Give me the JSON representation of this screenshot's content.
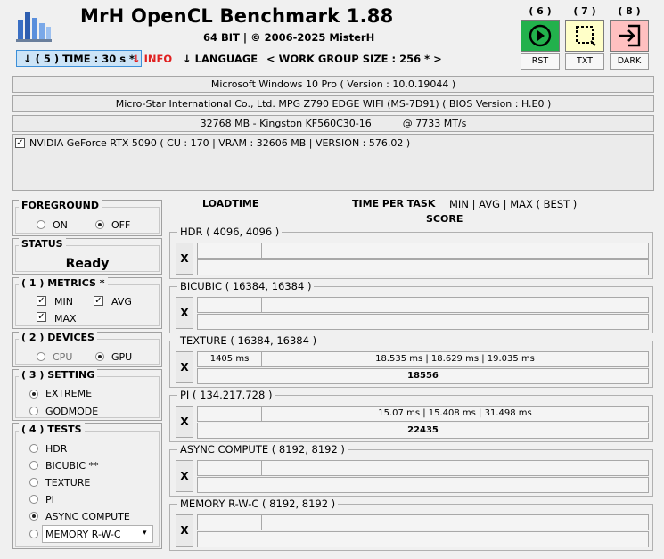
{
  "header": {
    "title": "MrH OpenCL Benchmark 1.88",
    "subtitle": "64 BIT | ©  2006-2025 MisterH"
  },
  "toolbar": {
    "run": {
      "number": "( 6 )",
      "label": "RST",
      "color": "#22b14c"
    },
    "txt": {
      "number": "( 7 )",
      "label": "TXT",
      "color": "#ffffc8"
    },
    "dark": {
      "number": "( 8 )",
      "label": "DARK",
      "color": "#ffc0c0"
    }
  },
  "menu": {
    "time": "↓ ( 5 ) TIME : 30 s *",
    "info": "↓ INFO",
    "language": "↓ LANGUAGE",
    "workgroup": "< WORK GROUP SIZE : 256 * >",
    "info_color": "#e02020"
  },
  "system": {
    "os": "Microsoft Windows 10 Pro ( Version : 10.0.19044 )",
    "board": "Micro-Star International Co., Ltd. MPG Z790 EDGE WIFI (MS-7D91) ( BIOS Version : H.E0 )",
    "memory": "32768 MB - Kingston KF560C30-16          @ 7733 MT/s",
    "gpu": "NVIDIA GeForce RTX 5090 ( CU : 170 | VRAM : 32606 MB | VERSION : 576.02 )"
  },
  "foreground": {
    "title": "FOREGROUND",
    "on": "ON",
    "off": "OFF",
    "selected": "OFF"
  },
  "status": {
    "title": "STATUS",
    "value": "Ready"
  },
  "metrics": {
    "title": "( 1 ) METRICS *",
    "min": "MIN",
    "avg": "AVG",
    "max": "MAX"
  },
  "devices": {
    "title": "( 2 ) DEVICES",
    "cpu": "CPU",
    "gpu": "GPU",
    "selected": "GPU"
  },
  "setting": {
    "title": "( 3 ) SETTING",
    "extreme": "EXTREME",
    "godmode": "GODMODE",
    "selected": "EXTREME"
  },
  "tests_menu": {
    "title": "( 4 ) TESTS",
    "items": [
      "HDR",
      "BICUBIC **",
      "TEXTURE",
      "PI",
      "ASYNC COMPUTE",
      "MEMORY R-W-C"
    ],
    "selected": "ASYNC COMPUTE"
  },
  "columns": {
    "loadtime": "LOADTIME",
    "time_per_task": "TIME PER TASK",
    "minavgmax": "MIN | AVG | MAX ( BEST )",
    "score": "SCORE"
  },
  "results": [
    {
      "name": "HDR ( 4096, 4096 )",
      "button": "X",
      "loadtime": "",
      "times": "",
      "score": ""
    },
    {
      "name": "BICUBIC ( 16384, 16384 )",
      "button": "X",
      "loadtime": "",
      "times": "",
      "score": ""
    },
    {
      "name": "TEXTURE ( 16384, 16384 )",
      "button": "X",
      "loadtime": "1405 ms",
      "times": "18.535 ms | 18.629 ms | 19.035 ms",
      "score": "18556"
    },
    {
      "name": "PI ( 134.217.728 )",
      "button": "X",
      "loadtime": "",
      "times": "15.07 ms | 15.408 ms | 31.498 ms",
      "score": "22435"
    },
    {
      "name": "ASYNC COMPUTE ( 8192, 8192 )",
      "button": "X",
      "loadtime": "",
      "times": "",
      "score": ""
    },
    {
      "name": "MEMORY R-W-C ( 8192, 8192 )",
      "button": "X",
      "loadtime": "",
      "times": "",
      "score": ""
    }
  ]
}
